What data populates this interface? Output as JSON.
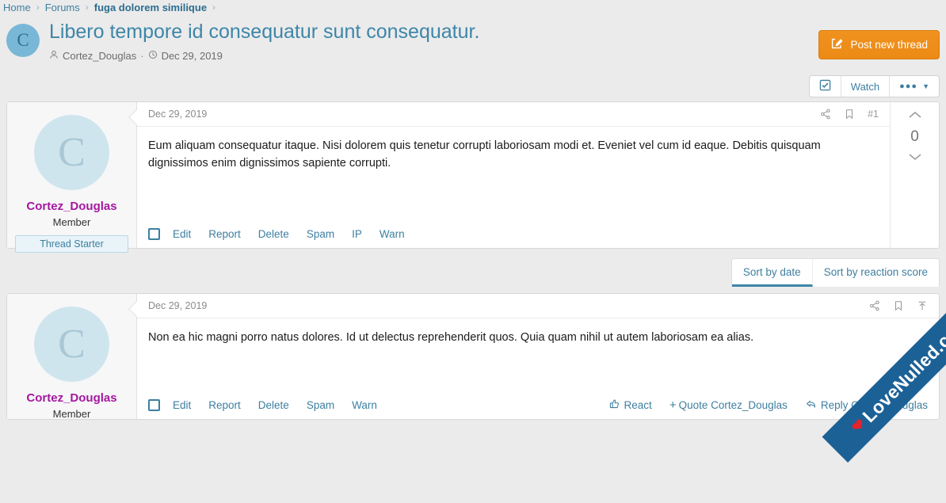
{
  "breadcrumb": {
    "items": [
      {
        "label": "Home",
        "bold": false
      },
      {
        "label": "Forums",
        "bold": false
      },
      {
        "label": "fuga dolorem similique",
        "bold": true
      }
    ],
    "separator": "›"
  },
  "thread": {
    "avatar_letter": "C",
    "title": "Libero tempore id consequatur sunt consequatur.",
    "author": "Cortez_Douglas",
    "separator": "·",
    "date": "Dec 29, 2019",
    "post_new_label": "Post new thread"
  },
  "toolbar": {
    "watch_label": "Watch",
    "more_label": "•••"
  },
  "sort": {
    "tabs": [
      {
        "label": "Sort by date",
        "active": true
      },
      {
        "label": "Sort by reaction score",
        "active": false
      }
    ]
  },
  "posts": [
    {
      "avatar_letter": "C",
      "user_name": "Cortez_Douglas",
      "user_title": "Member",
      "user_banner": "Thread Starter",
      "date": "Dec 29, 2019",
      "post_number": "#1",
      "text": "Eum aliquam consequatur itaque. Nisi dolorem quis tenetur corrupti laboriosam modi et. Eveniet vel cum id eaque. Debitis quisquam dignissimos enim dignissimos sapiente corrupti.",
      "actions": [
        "Edit",
        "Report",
        "Delete",
        "Spam",
        "IP",
        "Warn"
      ],
      "vote_count": "0"
    },
    {
      "avatar_letter": "C",
      "user_name": "Cortez_Douglas",
      "user_title": "Member",
      "date": "Dec 29, 2019",
      "text": "Non ea hic magni porro natus dolores. Id ut delectus reprehenderit quos. Quia quam nihil ut autem laboriosam ea alias.",
      "actions": [
        "Edit",
        "Report",
        "Delete",
        "Spam",
        "Warn"
      ],
      "react_label": "React",
      "quote_label": "Quote Cortez_Douglas",
      "reply_label": "Reply Cortez_Douglas"
    }
  ],
  "watermark": {
    "text": "LoveNulled.com"
  },
  "colors": {
    "accent": "#3d7fa0",
    "brand_orange": "#ec8a15",
    "username": "#a5179f",
    "watermark_band": "#1c6196"
  }
}
